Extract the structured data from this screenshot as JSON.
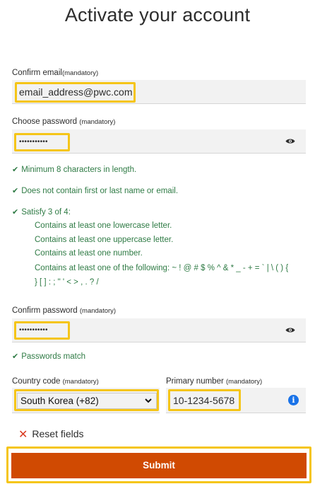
{
  "page": {
    "title": "Activate your account"
  },
  "confirm_email": {
    "label": "Confirm email",
    "mandatory": "(mandatory)",
    "value": "email_address@pwc.com"
  },
  "choose_password": {
    "label": "Choose password ",
    "mandatory": "(mandatory)",
    "value_masked": "•••••••••••"
  },
  "rules": {
    "min_length": "Minimum 8 characters in length.",
    "no_name": "Does not contain first or last name or email.",
    "satisfy": "Satisfy 3 of 4:",
    "lowercase": "Contains at least one lowercase letter.",
    "uppercase": "Contains at least one uppercase letter.",
    "number": "Contains at least one number.",
    "special_1": "Contains at least one of the following: ~ ! @ # $ % ^ & * _ - + = ` | \\ ( ) {",
    "special_2": "} [ ] : ; \" ' < > , . ? /"
  },
  "confirm_password": {
    "label": "Confirm password ",
    "mandatory": "(mandatory)",
    "value_masked": "•••••••••••",
    "match": "Passwords match"
  },
  "country_code": {
    "label": "Country code ",
    "mandatory": "(mandatory)",
    "selected": "South Korea (+82)"
  },
  "primary_number": {
    "label": "Primary number ",
    "mandatory": "(mandatory)",
    "value": "10-1234-5678"
  },
  "actions": {
    "reset": "Reset fields",
    "submit": "Submit"
  },
  "colors": {
    "accent": "#d04a02",
    "highlight": "#f5c518",
    "success": "#2f7b45",
    "info": "#1a73e8"
  },
  "icons": {
    "check": "check-icon",
    "eye": "eye-icon",
    "info": "info-icon",
    "reset": "close-icon",
    "dropdown": "chevron-down-icon"
  }
}
